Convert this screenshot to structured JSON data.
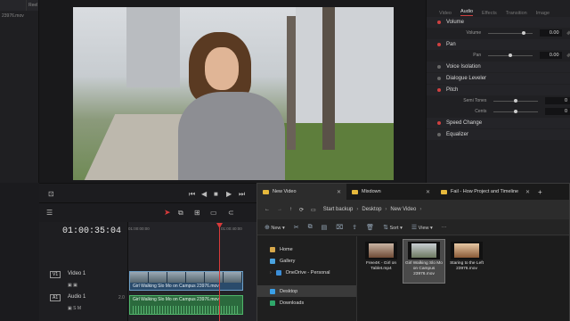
{
  "media_panel": {
    "header_label": "Reel",
    "file_label": "23976.mov"
  },
  "inspector": {
    "tabs": [
      "Video",
      "Audio",
      "Effects",
      "Transition",
      "Image"
    ],
    "sections": {
      "volume": "Volume",
      "volume_param": "Volume",
      "volume_value": "0.00",
      "pan": "Pan",
      "pan_param": "Pan",
      "pan_value": "0.00",
      "voice_isolation": "Voice Isolation",
      "dialogue_leveler": "Dialogue Leveler",
      "pitch": "Pitch",
      "semitones": "Semi Tones",
      "semitones_value": "0",
      "cents": "Cents",
      "cents_value": "0",
      "speed_change": "Speed Change",
      "equalizer": "Equalizer"
    }
  },
  "timeline": {
    "timecode": "01:00:35:04",
    "ruler_start": "01:00:00:00",
    "ruler_mark": "01:00:40:00",
    "video_track": {
      "tag": "V1",
      "label": "Video 1",
      "clip": "Girl Walking Slo Mo on Campus 23976.mov"
    },
    "audio_track": {
      "tag": "A1",
      "label": "Audio 1",
      "level": "2.0",
      "clip": "Girl Walking Slo Mo on Campus 23976.mov"
    }
  },
  "explorer": {
    "tabs": [
      {
        "label": "New Video",
        "active": true
      },
      {
        "label": "Mixdown",
        "active": false
      },
      {
        "label": "Fail - How Project and Timeline",
        "active": false
      }
    ],
    "breadcrumb": [
      "Start backup",
      "Desktop",
      "New Video"
    ],
    "commands": {
      "new": "New",
      "sort": "Sort",
      "view": "View"
    },
    "nav": {
      "home": "Home",
      "gallery": "Gallery",
      "onedrive": "OneDrive - Personal",
      "desktop": "Desktop",
      "downloads": "Downloads"
    },
    "files": [
      {
        "name": "Free4K - Girl on Tablet.mp4"
      },
      {
        "name": "Girl Walking Slo Mo on Campus 23976.mov"
      },
      {
        "name": "Staring to the Left 23976.mov"
      }
    ]
  }
}
